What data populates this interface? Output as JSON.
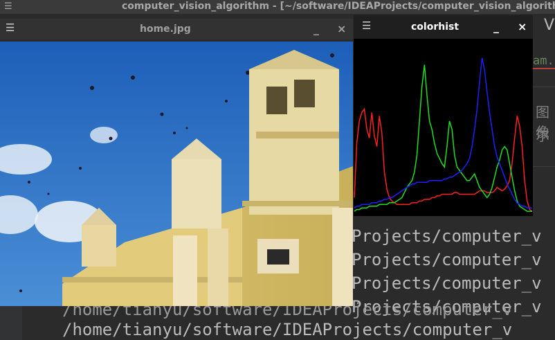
{
  "ide": {
    "window_title": "computer_vision_algorithm - [~/software/IDEAProjects/computer_vision_algorithm] - [c",
    "right_panel": {
      "top_text": "V",
      "green_text": "am.",
      "cjk_line1": "图像",
      "cjk_line2": "尔"
    },
    "console_lines": [
      "Projects/computer_v",
      "Projects/computer_v",
      "Projects/computer_v",
      "Projects/computer_v",
      "/home/tianyu/software/IDEAProjects/computer_v"
    ],
    "partial_line": "/home/tianyu/software/IDEAProjects/computer_v"
  },
  "home_window": {
    "title": "home.jpg",
    "minimize": "_",
    "close": "×"
  },
  "colorhist_window": {
    "title": "colorhist",
    "minimize": "_",
    "close": "×"
  },
  "histogram": {
    "colors": {
      "red": "#ff2020",
      "green": "#20e020",
      "blue": "#2020ff"
    },
    "red": [
      0.1,
      0.42,
      0.55,
      0.6,
      0.62,
      0.5,
      0.45,
      0.6,
      0.46,
      0.4,
      0.58,
      0.48,
      0.25,
      0.15,
      0.1,
      0.08,
      0.07,
      0.06,
      0.06,
      0.06,
      0.06,
      0.06,
      0.06,
      0.07,
      0.07,
      0.07,
      0.08,
      0.08,
      0.09,
      0.09,
      0.09,
      0.1,
      0.1,
      0.11,
      0.11,
      0.12,
      0.12,
      0.12,
      0.12,
      0.12,
      0.13,
      0.13,
      0.12,
      0.12,
      0.12,
      0.12,
      0.12,
      0.12,
      0.12,
      0.13,
      0.14,
      0.14,
      0.14,
      0.13,
      0.13,
      0.13,
      0.14,
      0.16,
      0.15,
      0.14,
      0.15,
      0.17,
      0.2,
      0.3,
      0.45,
      0.58,
      0.52,
      0.4,
      0.2,
      0.08,
      0.03,
      0.02
    ],
    "green": [
      0.02,
      0.03,
      0.03,
      0.04,
      0.04,
      0.04,
      0.05,
      0.05,
      0.05,
      0.05,
      0.06,
      0.06,
      0.06,
      0.06,
      0.07,
      0.07,
      0.07,
      0.08,
      0.09,
      0.1,
      0.13,
      0.16,
      0.18,
      0.2,
      0.25,
      0.35,
      0.55,
      0.75,
      0.88,
      0.7,
      0.55,
      0.5,
      0.42,
      0.36,
      0.33,
      0.3,
      0.28,
      0.4,
      0.55,
      0.5,
      0.35,
      0.28,
      0.26,
      0.24,
      0.22,
      0.2,
      0.2,
      0.22,
      0.24,
      0.2,
      0.16,
      0.14,
      0.12,
      0.1,
      0.12,
      0.16,
      0.22,
      0.28,
      0.32,
      0.38,
      0.4,
      0.38,
      0.3,
      0.22,
      0.14,
      0.08,
      0.05,
      0.04,
      0.03,
      0.02,
      0.02,
      0.02
    ],
    "blue": [
      0.04,
      0.05,
      0.05,
      0.06,
      0.06,
      0.06,
      0.06,
      0.07,
      0.07,
      0.07,
      0.08,
      0.08,
      0.09,
      0.09,
      0.1,
      0.1,
      0.11,
      0.12,
      0.13,
      0.14,
      0.15,
      0.16,
      0.17,
      0.18,
      0.18,
      0.19,
      0.19,
      0.19,
      0.19,
      0.19,
      0.2,
      0.2,
      0.2,
      0.2,
      0.2,
      0.2,
      0.21,
      0.21,
      0.22,
      0.22,
      0.23,
      0.24,
      0.25,
      0.26,
      0.28,
      0.3,
      0.33,
      0.4,
      0.5,
      0.62,
      0.78,
      0.92,
      0.85,
      0.72,
      0.6,
      0.5,
      0.4,
      0.34,
      0.3,
      0.26,
      0.22,
      0.18,
      0.15,
      0.12,
      0.09,
      0.07,
      0.06,
      0.05,
      0.05,
      0.04,
      0.04,
      0.04
    ]
  }
}
